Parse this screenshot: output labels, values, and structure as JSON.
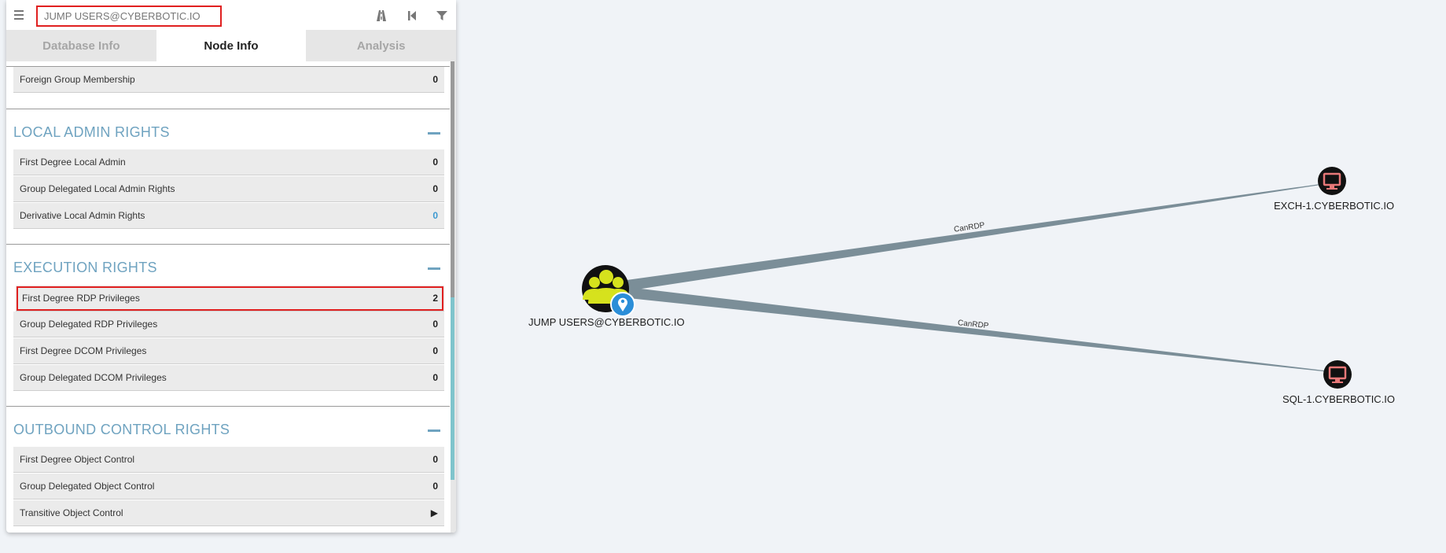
{
  "search": {
    "value": "JUMP USERS@CYBERBOTIC.IO"
  },
  "toolbar": {
    "path_icon": "road-icon",
    "back_icon": "skip-back-icon",
    "filter_icon": "filter-icon"
  },
  "tabs": [
    {
      "label": "Database Info",
      "active": false
    },
    {
      "label": "Node Info",
      "active": true
    },
    {
      "label": "Analysis",
      "active": false
    }
  ],
  "sections": {
    "group_membership": {
      "rows": [
        {
          "label": "Foreign Group Membership",
          "value": "0"
        }
      ]
    },
    "local_admin": {
      "title": "LOCAL ADMIN RIGHTS",
      "rows": [
        {
          "label": "First Degree Local Admin",
          "value": "0"
        },
        {
          "label": "Group Delegated Local Admin Rights",
          "value": "0"
        },
        {
          "label": "Derivative Local Admin Rights",
          "value": "0"
        }
      ]
    },
    "execution": {
      "title": "EXECUTION RIGHTS",
      "rows": [
        {
          "label": "First Degree RDP Privileges",
          "value": "2"
        },
        {
          "label": "Group Delegated RDP Privileges",
          "value": "0"
        },
        {
          "label": "First Degree DCOM Privileges",
          "value": "0"
        },
        {
          "label": "Group Delegated DCOM Privileges",
          "value": "0"
        }
      ]
    },
    "outbound": {
      "title": "OUTBOUND CONTROL RIGHTS",
      "rows": [
        {
          "label": "First Degree Object Control",
          "value": "0"
        },
        {
          "label": "Group Delegated Object Control",
          "value": "0"
        },
        {
          "label": "Transitive Object Control",
          "value": "▶"
        }
      ]
    }
  },
  "graph": {
    "nodes": {
      "group": {
        "label": "JUMP USERS@CYBERBOTIC.IO",
        "icon": "users-group-icon"
      },
      "exch": {
        "label": "EXCH-1.CYBERBOTIC.IO",
        "icon": "computer-icon"
      },
      "sql": {
        "label": "SQL-1.CYBERBOTIC.IO",
        "icon": "computer-icon"
      }
    },
    "edges": [
      {
        "label": "CanRDP"
      },
      {
        "label": "CanRDP"
      }
    ],
    "colors": {
      "edge": "#7b8e98",
      "group_fill": "#d6e21d",
      "computer_fill": "#e77878",
      "node_bg": "#111111",
      "highlight": "#e02020",
      "section_title": "#6fa3c0"
    }
  }
}
